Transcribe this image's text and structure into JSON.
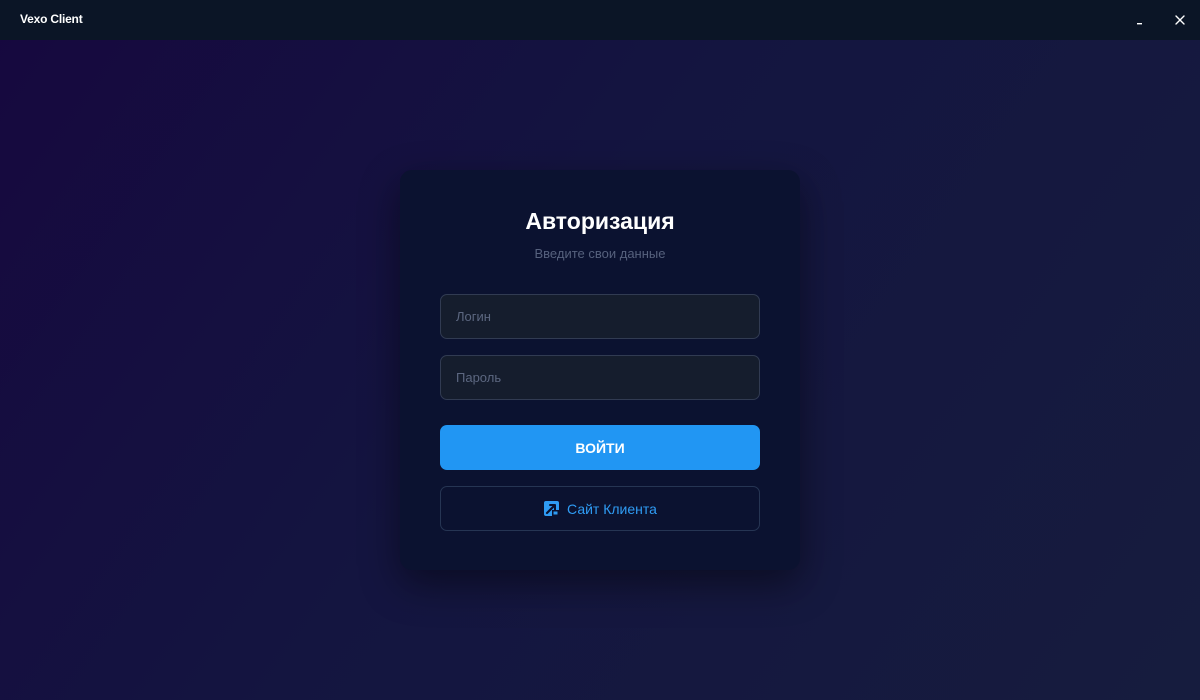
{
  "window": {
    "title": "Vexo Client",
    "minimize_label": "_",
    "close_label": "✕"
  },
  "auth": {
    "title": "Авторизация",
    "subtitle": "Введите свои данные",
    "login_placeholder": "Логин",
    "login_value": "",
    "password_placeholder": "Пароль",
    "password_value": "",
    "submit_label": "ВОЙТИ",
    "site_link_label": "Сайт Клиента",
    "site_link_icon": "external-link-icon"
  },
  "colors": {
    "accent": "#2196f3",
    "link": "#2f9cf4",
    "card_background": "#0b1230",
    "titlebar_background": "#0b1526"
  }
}
